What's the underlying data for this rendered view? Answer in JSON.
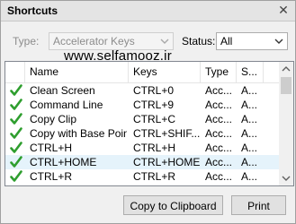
{
  "panel": {
    "title": "Shortcuts",
    "close_glyph": "✕"
  },
  "filters": {
    "type_label": "Type:",
    "type_value": "Accelerator Keys",
    "status_label": "Status:",
    "status_value": "All"
  },
  "watermark": "www.selfamooz.ir",
  "list": {
    "columns": [
      "Name",
      "Keys",
      "Type",
      "S..."
    ],
    "rows": [
      {
        "name": "Clean Screen",
        "keys": "CTRL+0",
        "type": "Acc...",
        "status": "A..."
      },
      {
        "name": "Command Line",
        "keys": "CTRL+9",
        "type": "Acc...",
        "status": "A..."
      },
      {
        "name": "Copy Clip",
        "keys": "CTRL+C",
        "type": "Acc...",
        "status": "A..."
      },
      {
        "name": "Copy with Base Point",
        "keys": "CTRL+SHIF...",
        "type": "Acc...",
        "status": "A..."
      },
      {
        "name": "CTRL+H",
        "keys": "CTRL+H",
        "type": "Acc...",
        "status": "A..."
      },
      {
        "name": "CTRL+HOME",
        "keys": "CTRL+HOME",
        "type": "Acc...",
        "status": "A..."
      },
      {
        "name": "CTRL+R",
        "keys": "CTRL+R",
        "type": "Acc...",
        "status": "A..."
      }
    ],
    "selected_index": 5
  },
  "buttons": {
    "copy_label": "Copy to Clipboard",
    "print_label": "Print"
  },
  "colors": {
    "check_green": "#2e9e2e",
    "selection": "#e5f3fb"
  }
}
